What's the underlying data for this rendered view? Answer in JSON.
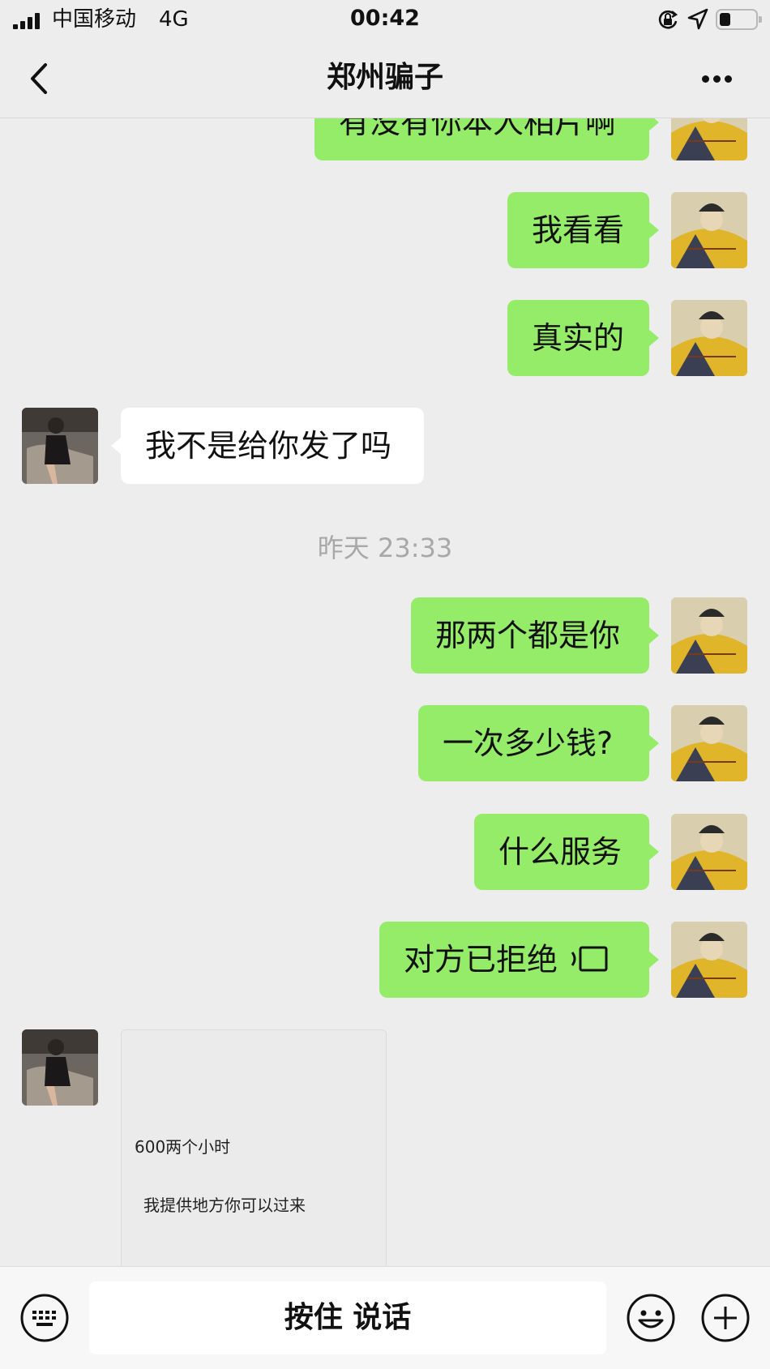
{
  "status_bar": {
    "carrier": "中国移动",
    "network": "4G",
    "time": "00:42"
  },
  "nav": {
    "title": "郑州骗子"
  },
  "messages": [
    {
      "direction": "out",
      "text": "有没有你本人相片啊"
    },
    {
      "direction": "out",
      "text": "我看看"
    },
    {
      "direction": "out",
      "text": "真实的"
    },
    {
      "direction": "in",
      "text": "我不是给你发了吗"
    },
    {
      "direction": "out",
      "text": "那两个都是你"
    },
    {
      "direction": "out",
      "text": "一次多少钱?"
    },
    {
      "direction": "out",
      "text": "什么服务"
    },
    {
      "direction": "out",
      "text": "对方已拒绝",
      "icon": "voice-call-icon"
    }
  ],
  "timestamp": "昨天 23:33",
  "image_message": {
    "line1": "600两个小时",
    "line2": "我提供地方你可以过来"
  },
  "input_bar": {
    "voice_label": "按住 说话"
  },
  "colors": {
    "background": "#ededed",
    "outgoing_bubble": "#95ec69",
    "incoming_bubble": "#ffffff",
    "timestamp_text": "#a8a8a8"
  }
}
